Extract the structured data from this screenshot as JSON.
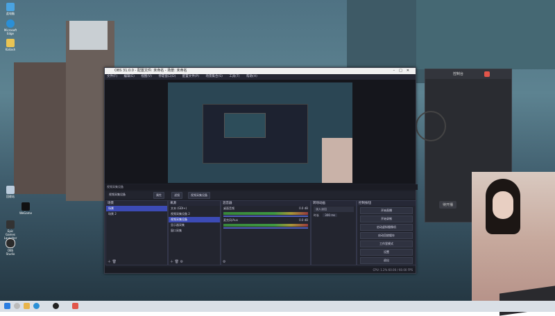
{
  "desktop": {
    "icons": [
      {
        "label": "此电脑",
        "icon": "computer-icon"
      },
      {
        "label": "Microsoft Edge",
        "icon": "edge-icon"
      },
      {
        "label": "Kailash",
        "icon": "folder-icon"
      },
      {
        "label": "OBS Studio",
        "icon": "obs-icon"
      },
      {
        "label": "回收站",
        "icon": "recycle-bin-icon"
      },
      {
        "label": "WeGame",
        "icon": "wegame-icon"
      },
      {
        "label": "Epic Games Launcher",
        "icon": "epic-icon"
      }
    ]
  },
  "obs": {
    "title": "OBS 31.0.0 - 配置文件: 未命名 - 场景: 未命名",
    "menu": [
      "文件(F)",
      "编辑(E)",
      "视图(V)",
      "停靠窗口(D)",
      "配置文件(P)",
      "场景集合(S)",
      "工具(T)",
      "帮助(H)"
    ],
    "scene_bar_text": "视频采集设备",
    "toolbar": {
      "properties": "属性",
      "filters": "滤镜",
      "device": "视频采集设备"
    },
    "docks": {
      "scenes": {
        "title": "场景",
        "items": [
          "场景",
          "场景 2"
        ]
      },
      "sources": {
        "title": "来源",
        "items": [
          "文本 (GDI+)",
          "视频采集设备 2",
          "视频采集设备",
          "显示器采集",
          "窗口采集"
        ]
      },
      "mixer": {
        "title": "混音器",
        "channels": [
          {
            "name": "桌面音频",
            "db": "0.0 dB"
          },
          {
            "name": "麦克风/Aux",
            "db": "0.0 dB"
          }
        ]
      },
      "transitions": {
        "title": "转场动画",
        "type": "淡入淡出",
        "duration_label": "时长",
        "duration": "300 ms"
      },
      "controls": {
        "title": "控制按钮",
        "buttons": [
          "开始直播",
          "开始录制",
          "启动虚拟摄像机",
          "启动回放缓存",
          "工作室模式",
          "设置",
          "退出"
        ]
      }
    },
    "status": "CPU: 1.2%  60.00 / 60.00 FPS"
  },
  "app2": {
    "tab": "控制台",
    "hint": "待开播"
  },
  "taskbar": {
    "icons": [
      "start-icon",
      "search-icon",
      "file-explorer-icon",
      "edge-icon",
      "obs-icon",
      "app-icon"
    ]
  }
}
